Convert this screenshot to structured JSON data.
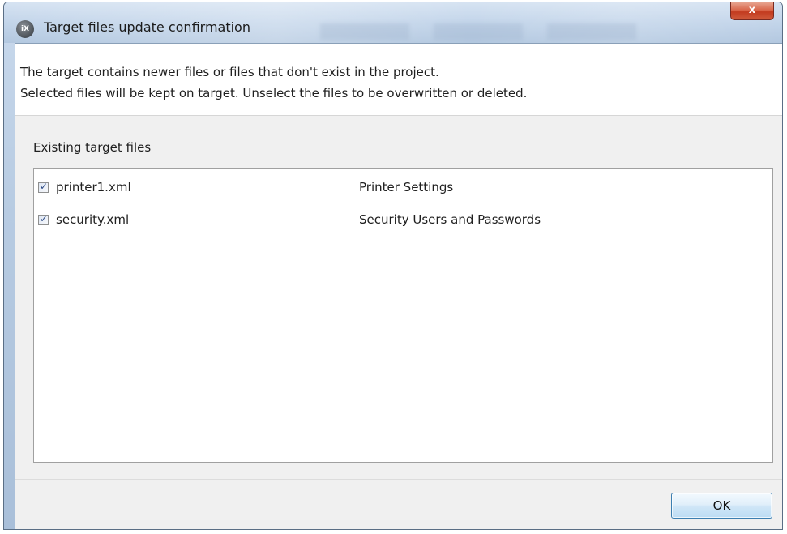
{
  "window": {
    "title": "Target files update confirmation",
    "app_icon_text": "iX",
    "close_glyph": "x"
  },
  "message": {
    "line1": "The target contains newer files or files that don't exist in the project.",
    "line2": "Selected files will be kept on target. Unselect the files to be overwritten or deleted."
  },
  "existing_files": {
    "label": "Existing target files",
    "rows": [
      {
        "file": "printer1.xml",
        "description": "Printer Settings",
        "checked": true
      },
      {
        "file": "security.xml",
        "description": "Security Users and Passwords",
        "checked": true
      }
    ]
  },
  "footer": {
    "ok_label": "OK"
  },
  "colors": {
    "title_bar": "#c3d5ea",
    "close_button": "#c23b1f",
    "ok_button_border": "#3c7fb1",
    "checkbox_mark": "#2d4b86"
  },
  "icons": {
    "app": "ix-app-icon",
    "close": "close-icon",
    "check": "checkmark-icon"
  }
}
